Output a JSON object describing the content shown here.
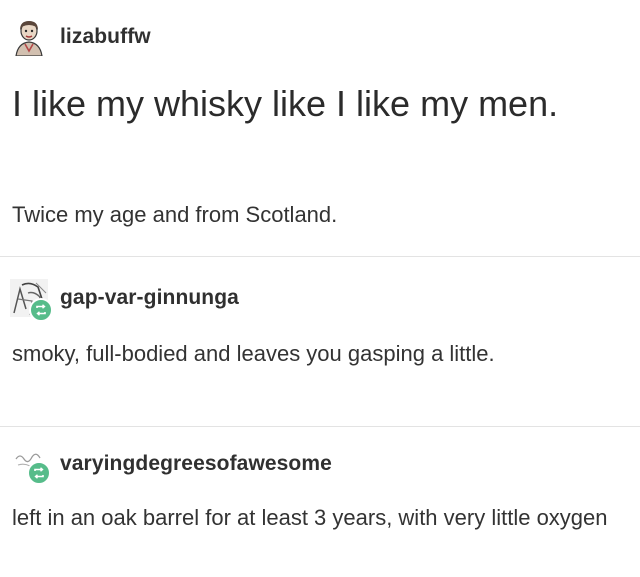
{
  "post": {
    "original": {
      "username": "lizabuffw",
      "avatar_icon": "woman-portrait-avatar",
      "title": "I like my whisky like I like my men.",
      "body": "Twice my age and from Scotland."
    },
    "replies": [
      {
        "username": "gap-var-ginnunga",
        "avatar_icon": "sketch-portrait-avatar",
        "badge_icon": "reblog-icon",
        "body": "smoky, full-bodied and leaves you gasping a little."
      },
      {
        "username": "varyingdegreesofawesome",
        "avatar_icon": "text-logo-avatar",
        "badge_icon": "reblog-icon",
        "body": "left in an oak barrel for at least 3 years, with very little oxygen"
      }
    ]
  },
  "colors": {
    "text": "#2f2f2f",
    "divider": "#e3e3e3",
    "reblog_badge": "#56bc8a"
  }
}
